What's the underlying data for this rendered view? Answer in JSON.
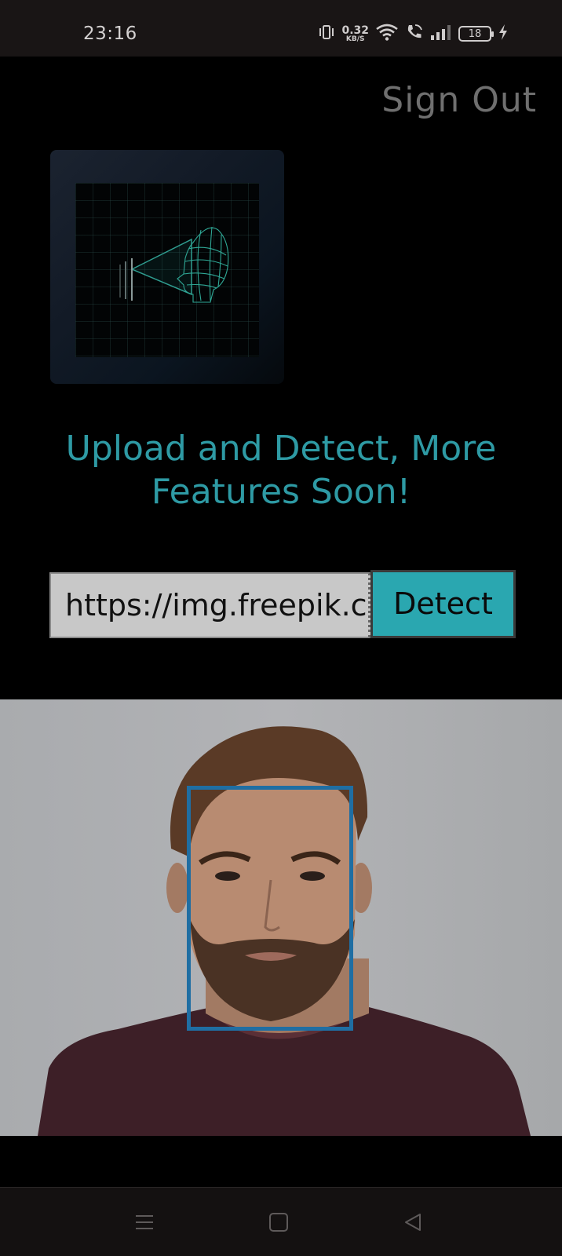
{
  "status_bar": {
    "time": "23:16",
    "net_speed_value": "0.32",
    "net_speed_unit": "KB/S",
    "battery_level": "18",
    "icons": [
      "vibrate-icon",
      "wifi-icon",
      "wifi-call-icon",
      "signal-icon",
      "battery-icon",
      "charging-icon"
    ]
  },
  "header": {
    "sign_out_label": "Sign Out"
  },
  "hero": {
    "logo_icon": "face-scan-icon",
    "headline": "Upload and Detect, More Features Soon!"
  },
  "form": {
    "url_value": "https://img.freepik.com/",
    "detect_label": "Detect"
  },
  "result": {
    "image_description_icon": "detected-portrait-image",
    "box_color": "#1f6ea3"
  },
  "nav": {
    "icons": [
      "menu-icon",
      "home-icon",
      "back-icon"
    ]
  },
  "colors": {
    "accent": "#2aa7b0",
    "headline": "#2e9aa4",
    "background": "#000000"
  }
}
